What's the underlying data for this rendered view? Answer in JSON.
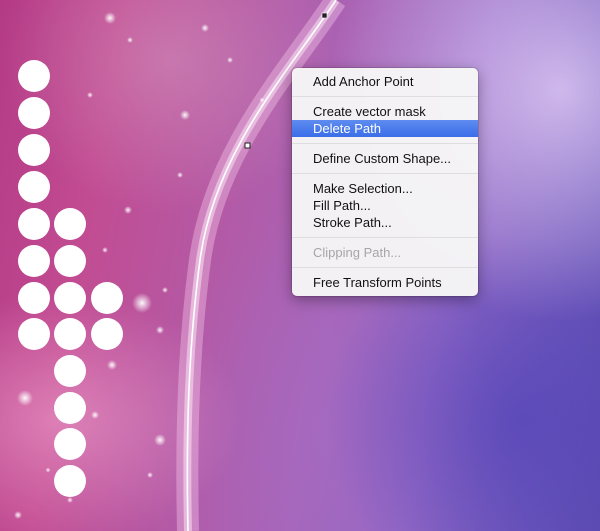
{
  "context_menu": {
    "items": [
      {
        "label": "Add Anchor Point",
        "state": "normal"
      },
      {
        "label": "Create vector mask",
        "state": "normal"
      },
      {
        "label": "Delete Path",
        "state": "highlighted"
      },
      {
        "label": "Define Custom Shape...",
        "state": "normal"
      },
      {
        "label": "Make Selection...",
        "state": "normal"
      },
      {
        "label": "Fill Path...",
        "state": "normal"
      },
      {
        "label": "Stroke Path...",
        "state": "normal"
      },
      {
        "label": "Clipping Path...",
        "state": "disabled"
      },
      {
        "label": "Free Transform Points",
        "state": "normal"
      }
    ]
  },
  "colors": {
    "highlight": "#3b6de8",
    "menu_background": "#f6f6f6",
    "path_stroke": "#ffffff",
    "canvas_magenta": "#b43a86",
    "canvas_violet": "#5d4cb0"
  },
  "icons": {
    "anchor_point": "anchor-point-icon",
    "dots": "white-circle-dot-icon"
  }
}
